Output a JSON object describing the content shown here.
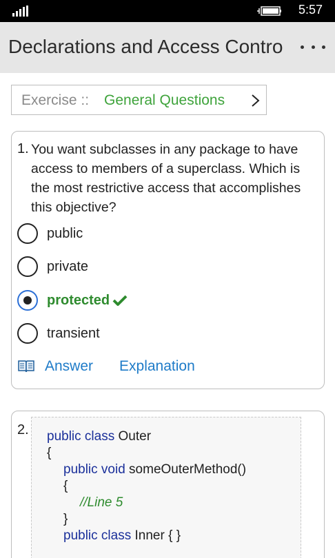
{
  "status": {
    "time": "5:57"
  },
  "app": {
    "title": "Declarations and Access Contro"
  },
  "exercise": {
    "label": "Exercise ::",
    "category": "General Questions"
  },
  "questions": [
    {
      "number": "1.",
      "text": "You want subclasses in any package to have access to members of a superclass. Which is the most restrictive access that accomplishes this objective?",
      "options": [
        {
          "label": "public",
          "selected": false
        },
        {
          "label": "private",
          "selected": false
        },
        {
          "label": "protected",
          "selected": true,
          "correct": true
        },
        {
          "label": "transient",
          "selected": false
        }
      ],
      "answer_label": "Answer",
      "explanation_label": "Explanation"
    },
    {
      "number": "2.",
      "code": {
        "l1_kw": "public class",
        "l1_txt": " Outer",
        "l2": "{",
        "l3_kw": "public void",
        "l3_txt": " someOuterMethod()",
        "l4": "{",
        "l5": "//Line 5",
        "l6": "}",
        "l7_kw": "public class",
        "l7_txt": " Inner { }"
      }
    }
  ],
  "colors": {
    "correct": "#2e8b2e",
    "link": "#1e7bc8",
    "keyword": "#1a2f9a",
    "category": "#3ea33b"
  },
  "icons": [
    "signal-icon",
    "battery-icon",
    "more-icon",
    "chevron-right-icon",
    "check-icon",
    "book-icon"
  ]
}
